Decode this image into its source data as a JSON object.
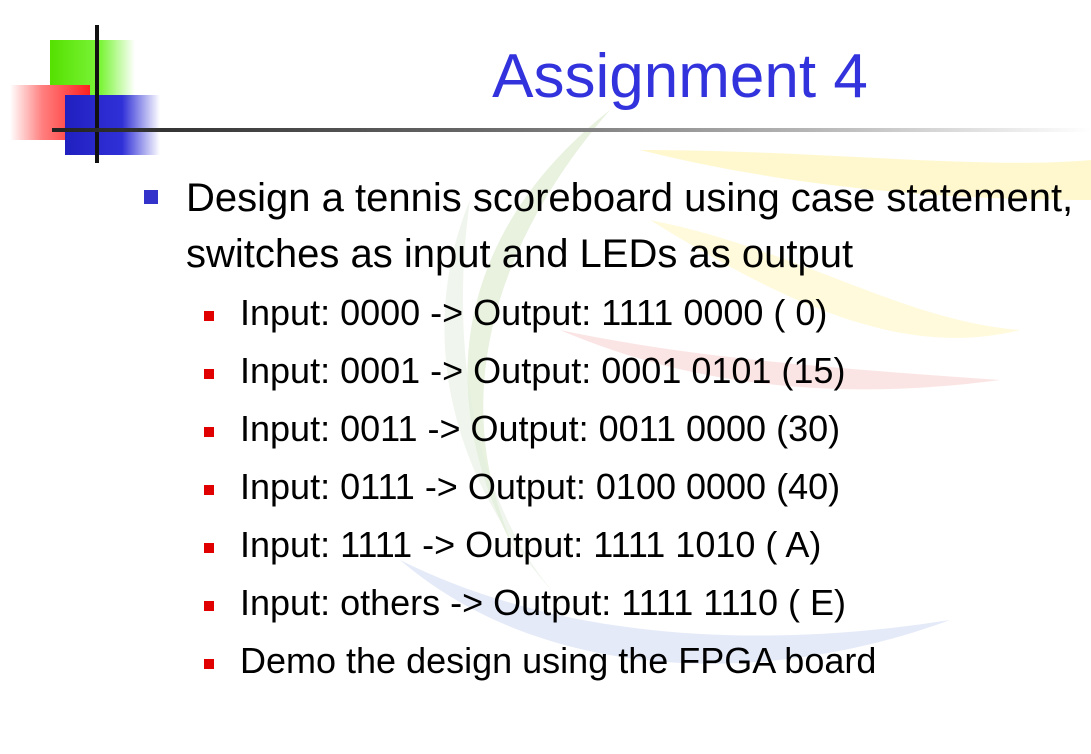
{
  "slide": {
    "title": "Assignment 4",
    "main_bullet": "Design a tennis scoreboard using case statement, switches as input  and LEDs as output",
    "sub_bullets": [
      "Input: 0000 -> Output: 1111 0000 ( 0)",
      "Input: 0001 -> Output: 0001 0101 (15)",
      "Input: 0011 -> Output: 0011 0000 (30)",
      "Input: 0111 -> Output: 0100 0000 (40)",
      "Input: 1111 -> Output: 1111 1010 ( A)",
      "Input: others -> Output: 1111 1110 ( E)",
      "Demo the design using the FPGA board"
    ]
  },
  "colors": {
    "title": "#3333dd",
    "level1_bullet": "#3333cc",
    "level2_bullet": "#e00000"
  }
}
